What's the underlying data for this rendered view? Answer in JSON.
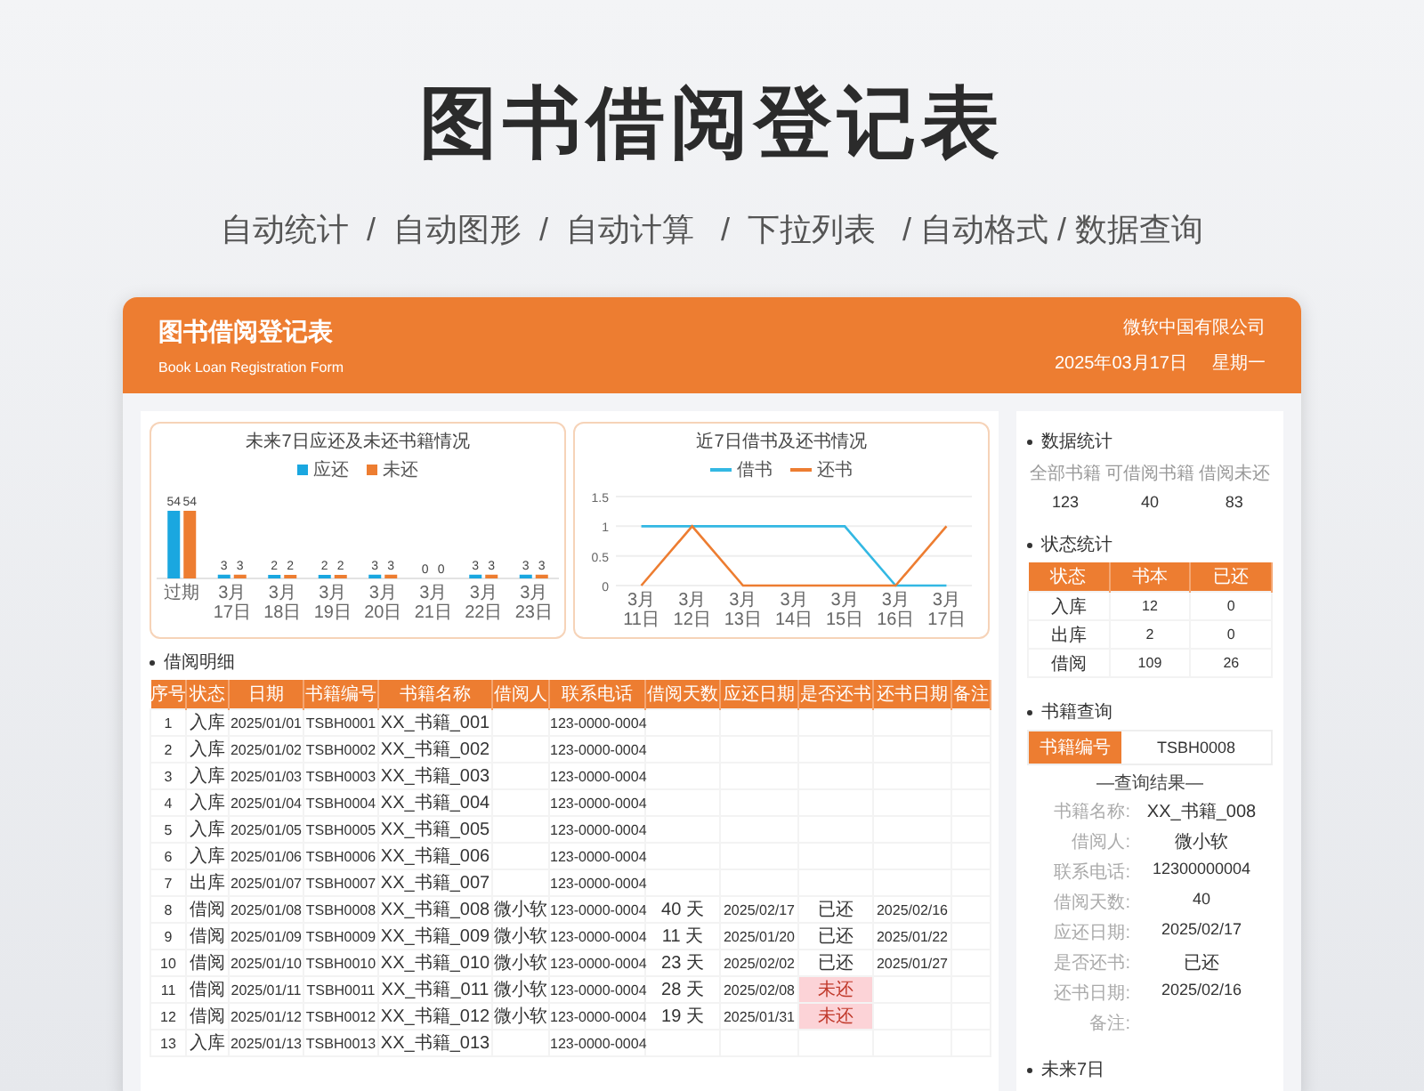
{
  "page_title": "图书借阅登记表",
  "subtitle": "自动统计  /  自动图形  /  自动计算   /  下拉列表   / 自动格式 / 数据查询",
  "card_header": {
    "title": "图书借阅登记表",
    "subtitle": "Book Loan Registration Form",
    "company": "微软中国有限公司",
    "date": "2025年03月17日",
    "weekday": "星期一"
  },
  "charts": [
    {
      "chart_data": {
        "type": "bar",
        "title": "未来7日应还及未还书籍情况",
        "categories": [
          "过期",
          "3月17日",
          "3月18日",
          "3月19日",
          "3月20日",
          "3月21日",
          "3月22日",
          "3月23日"
        ],
        "data_labels": true,
        "series": [
          {
            "name": "应还",
            "color": "#1aa7e0",
            "values": [
              54,
              3,
              2,
              2,
              3,
              0,
              3,
              3
            ]
          },
          {
            "name": "未还",
            "color": "#ed7d31",
            "values": [
              54,
              3,
              2,
              2,
              3,
              0,
              3,
              3
            ]
          }
        ]
      }
    },
    {
      "chart_data": {
        "type": "line",
        "title": "近7日借书及还书情况",
        "categories": [
          "3月11日",
          "3月12日",
          "3月13日",
          "3月14日",
          "3月15日",
          "3月16日",
          "3月17日"
        ],
        "ylim": [
          0,
          1.5
        ],
        "yticks": [
          0,
          0.5,
          1,
          1.5
        ],
        "series": [
          {
            "name": "借书",
            "color": "#33b8e3",
            "values": [
              1,
              1,
              1,
              1,
              1,
              0,
              0
            ]
          },
          {
            "name": "还书",
            "color": "#ed7d31",
            "values": [
              0,
              1,
              0,
              0,
              0,
              0,
              1
            ]
          }
        ]
      }
    }
  ],
  "detail": {
    "heading": "借阅明细",
    "columns": [
      "序号",
      "状态",
      "日期",
      "书籍编号",
      "书籍名称",
      "借阅人",
      "联系电话",
      "借阅天数",
      "应还日期",
      "是否还书",
      "还书日期",
      "备注"
    ],
    "rows": [
      {
        "alert": false,
        "cells": [
          "1",
          "入库",
          "2025/01/01",
          "TSBH0001",
          "XX_书籍_001",
          null,
          "123-0000-0004",
          null,
          null,
          null,
          null,
          null
        ]
      },
      {
        "alert": false,
        "cells": [
          "2",
          "入库",
          "2025/01/02",
          "TSBH0002",
          "XX_书籍_002",
          null,
          "123-0000-0004",
          null,
          null,
          null,
          null,
          null
        ]
      },
      {
        "alert": false,
        "cells": [
          "3",
          "入库",
          "2025/01/03",
          "TSBH0003",
          "XX_书籍_003",
          null,
          "123-0000-0004",
          null,
          null,
          null,
          null,
          null
        ]
      },
      {
        "alert": false,
        "cells": [
          "4",
          "入库",
          "2025/01/04",
          "TSBH0004",
          "XX_书籍_004",
          null,
          "123-0000-0004",
          null,
          null,
          null,
          null,
          null
        ]
      },
      {
        "alert": false,
        "cells": [
          "5",
          "入库",
          "2025/01/05",
          "TSBH0005",
          "XX_书籍_005",
          null,
          "123-0000-0004",
          null,
          null,
          null,
          null,
          null
        ]
      },
      {
        "alert": false,
        "cells": [
          "6",
          "入库",
          "2025/01/06",
          "TSBH0006",
          "XX_书籍_006",
          null,
          "123-0000-0004",
          null,
          null,
          null,
          null,
          null
        ]
      },
      {
        "alert": false,
        "cells": [
          "7",
          "出库",
          "2025/01/07",
          "TSBH0007",
          "XX_书籍_007",
          null,
          "123-0000-0004",
          null,
          null,
          null,
          null,
          null
        ]
      },
      {
        "alert": false,
        "cells": [
          "8",
          "借阅",
          "2025/01/08",
          "TSBH0008",
          "XX_书籍_008",
          "微小软",
          "123-0000-0004",
          "40 天",
          "2025/02/17",
          "已还",
          "2025/02/16",
          null
        ]
      },
      {
        "alert": false,
        "cells": [
          "9",
          "借阅",
          "2025/01/09",
          "TSBH0009",
          "XX_书籍_009",
          "微小软",
          "123-0000-0004",
          "11 天",
          "2025/01/20",
          "已还",
          "2025/01/22",
          null
        ]
      },
      {
        "alert": false,
        "cells": [
          "10",
          "借阅",
          "2025/01/10",
          "TSBH0010",
          "XX_书籍_010",
          "微小软",
          "123-0000-0004",
          "23 天",
          "2025/02/02",
          "已还",
          "2025/01/27",
          null
        ]
      },
      {
        "alert": true,
        "cells": [
          "11",
          "借阅",
          "2025/01/11",
          "TSBH0011",
          "XX_书籍_011",
          "微小软",
          "123-0000-0004",
          "28 天",
          "2025/02/08",
          "未还",
          null,
          null
        ]
      },
      {
        "alert": true,
        "cells": [
          "12",
          "借阅",
          "2025/01/12",
          "TSBH0012",
          "XX_书籍_012",
          "微小软",
          "123-0000-0004",
          "19 天",
          "2025/01/31",
          "未还",
          null,
          null
        ]
      },
      {
        "alert": false,
        "cells": [
          "13",
          "入库",
          "2025/01/13",
          "TSBH0013",
          "XX_书籍_013",
          null,
          "123-0000-0004",
          null,
          null,
          null,
          null,
          null
        ]
      }
    ]
  },
  "sidebar": {
    "stats": {
      "heading": "数据统计",
      "items": [
        {
          "label": "全部书籍",
          "value": "123"
        },
        {
          "label": "可借阅书籍",
          "value": "40"
        },
        {
          "label": "借阅未还",
          "value": "83"
        }
      ]
    },
    "status": {
      "heading": "状态统计",
      "columns": [
        "状态",
        "书本",
        "已还"
      ],
      "rows": [
        [
          "入库",
          "12",
          "0"
        ],
        [
          "出库",
          "2",
          "0"
        ],
        [
          "借阅",
          "109",
          "26"
        ]
      ]
    },
    "query": {
      "heading": "书籍查询",
      "label": "书籍编号",
      "value": "TSBH0008",
      "result_title": "—查询结果—",
      "fields": [
        {
          "label": "书籍名称:",
          "value": "XX_书籍_008"
        },
        {
          "label": "借阅人:",
          "value": "微小软"
        },
        {
          "label": "联系电话:",
          "value": "12300000004"
        },
        {
          "label": "借阅天数:",
          "value": "40"
        },
        {
          "label": "应还日期:",
          "value": "2025/02/17"
        },
        {
          "label": "是否还书:",
          "value": "已还"
        },
        {
          "label": "还书日期:",
          "value": "2025/02/16"
        },
        {
          "label": "备注:"
        }
      ]
    },
    "next_heading": "未来7日"
  }
}
